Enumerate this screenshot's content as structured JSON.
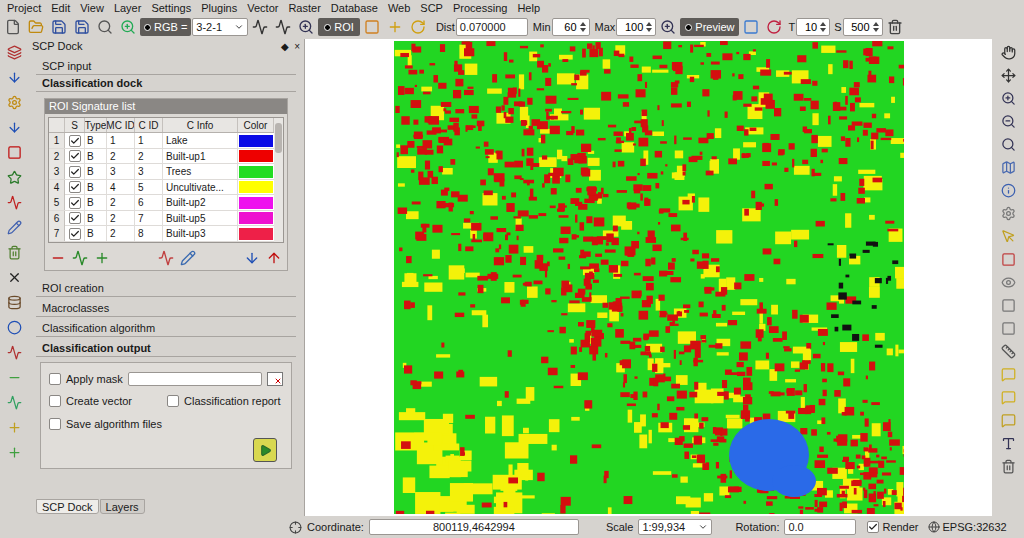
{
  "menu": [
    "Project",
    "Edit",
    "View",
    "Layer",
    "Settings",
    "Plugins",
    "Vector",
    "Raster",
    "Database",
    "Web",
    "SCP",
    "Processing",
    "Help"
  ],
  "toolbar": {
    "rgb_label": "RGB =",
    "rgb_value": "3-2-1",
    "roi": {
      "label": "ROI",
      "on": true
    },
    "dist": {
      "label": "Dist",
      "value": "0.070000"
    },
    "min": {
      "label": "Min",
      "value": "60"
    },
    "max": {
      "label": "Max",
      "value": "100"
    },
    "preview": {
      "label": "Preview",
      "on": true
    },
    "t": {
      "label": "T",
      "value": "10"
    },
    "s": {
      "label": "S",
      "value": "500"
    }
  },
  "dock": {
    "title": "SCP Dock",
    "title_buttons": [
      "◆",
      "×"
    ],
    "sections": [
      {
        "label": "SCP input",
        "bold": false
      },
      {
        "label": "Classification dock",
        "bold": true
      }
    ],
    "signature_list": {
      "title": "ROI Signature list",
      "columns": [
        "S",
        "Type",
        "MC ID",
        "C ID",
        "C Info",
        "Color"
      ],
      "rows": [
        {
          "num": "1",
          "checked": true,
          "type": "B",
          "mc_id": "1",
          "c_id": "1",
          "info": "Lake",
          "color": "#0a0ae6"
        },
        {
          "num": "2",
          "checked": true,
          "type": "B",
          "mc_id": "2",
          "c_id": "2",
          "info": "Built-up1",
          "color": "#ee0000"
        },
        {
          "num": "3",
          "checked": true,
          "type": "B",
          "mc_id": "3",
          "c_id": "3",
          "info": "Trees",
          "color": "#22dd22"
        },
        {
          "num": "4",
          "checked": true,
          "type": "B",
          "mc_id": "4",
          "c_id": "5",
          "info": "Uncultivate...",
          "color": "#ffff00"
        },
        {
          "num": "5",
          "checked": true,
          "type": "B",
          "mc_id": "2",
          "c_id": "6",
          "info": "Built-up2",
          "color": "#ee10ee"
        },
        {
          "num": "6",
          "checked": true,
          "type": "B",
          "mc_id": "2",
          "c_id": "7",
          "info": "Built-up5",
          "color": "#ee10d0"
        },
        {
          "num": "7",
          "checked": true,
          "type": "B",
          "mc_id": "2",
          "c_id": "8",
          "info": "Built-up3",
          "color": "#ee2048"
        }
      ]
    },
    "subsections": [
      {
        "label": "ROI creation",
        "expanded": false
      },
      {
        "label": "Macroclasses",
        "expanded": false
      },
      {
        "label": "Classification algorithm",
        "expanded": false
      },
      {
        "label": "Classification output",
        "expanded": true
      }
    ],
    "output": {
      "rows": [
        [
          {
            "label": "Apply mask",
            "checked": false,
            "kind": "mask",
            "value": ""
          }
        ],
        [
          {
            "label": "Create vector",
            "checked": false,
            "kind": "check"
          },
          {
            "label": "Classification report",
            "checked": false,
            "kind": "check"
          }
        ],
        [
          {
            "label": "Save algorithm files",
            "checked": false,
            "kind": "check"
          }
        ]
      ]
    },
    "bottom_tabs": [
      {
        "label": "SCP Dock",
        "selected": true
      },
      {
        "label": "Layers",
        "selected": false
      }
    ]
  },
  "status_bar": {
    "coordinate_label": "Coordinate:",
    "coordinate": "800119,4642994",
    "scale_label": "Scale",
    "scale": "1:99,934",
    "rotation_label": "Rotation:",
    "rotation": "0.0",
    "render": {
      "label": "Render",
      "checked": true
    },
    "crs": "EPSG:32632"
  }
}
